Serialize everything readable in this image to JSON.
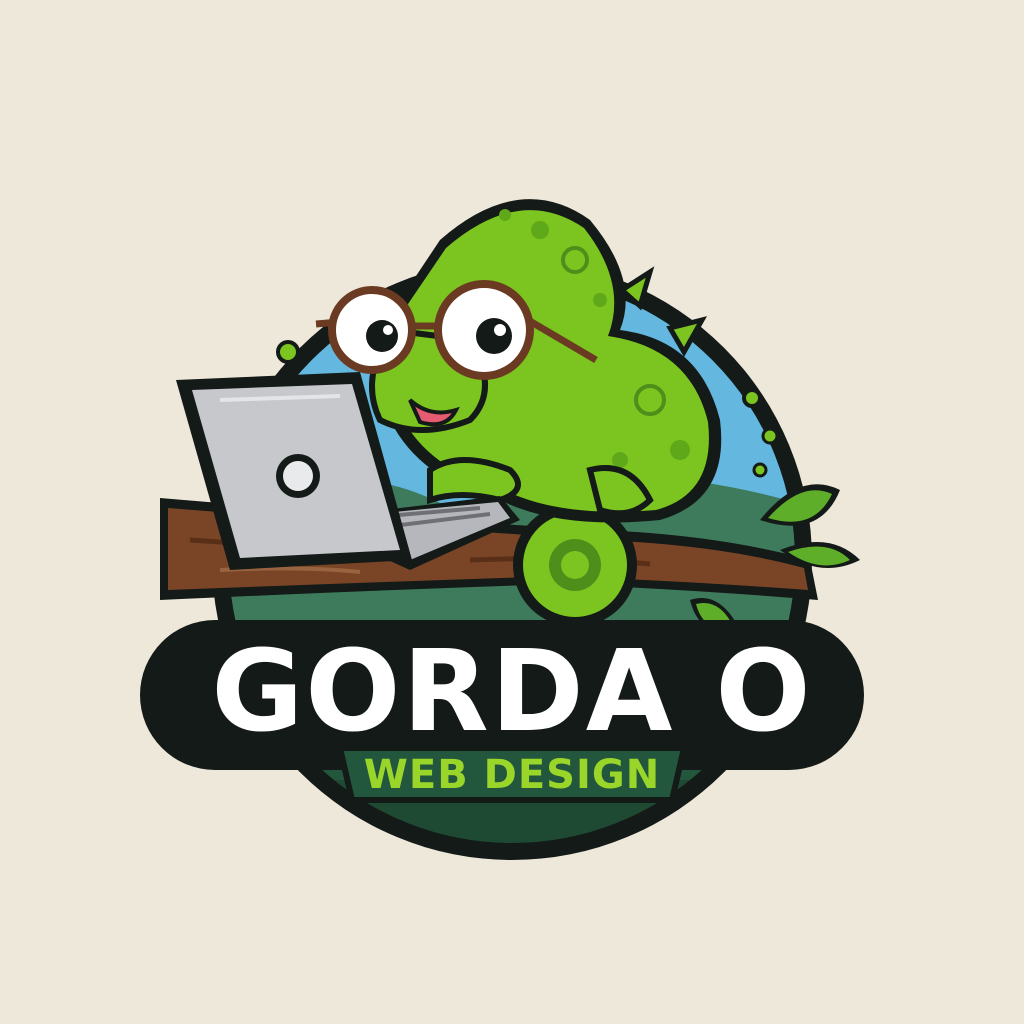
{
  "logo": {
    "wordmark": "GORDA O",
    "tagline": "WEB DESIGN"
  },
  "colors": {
    "background": "#EEE8DA",
    "outline": "#141A17",
    "sky": "#64B8E0",
    "hills": "#3E7B5C",
    "band": "#23573D",
    "chameleon": "#7CC41F",
    "chameleon_dark": "#4E8E1B",
    "tagline": "#9AD62A",
    "branch": "#7A4526",
    "laptop": "#C6C8CC",
    "glasses": "#6B3A22",
    "wordmark": "#FFFFFF"
  },
  "icons": [
    "chameleon-mascot-icon",
    "laptop-icon",
    "branch-icon",
    "leaf-icon",
    "glasses-icon"
  ]
}
